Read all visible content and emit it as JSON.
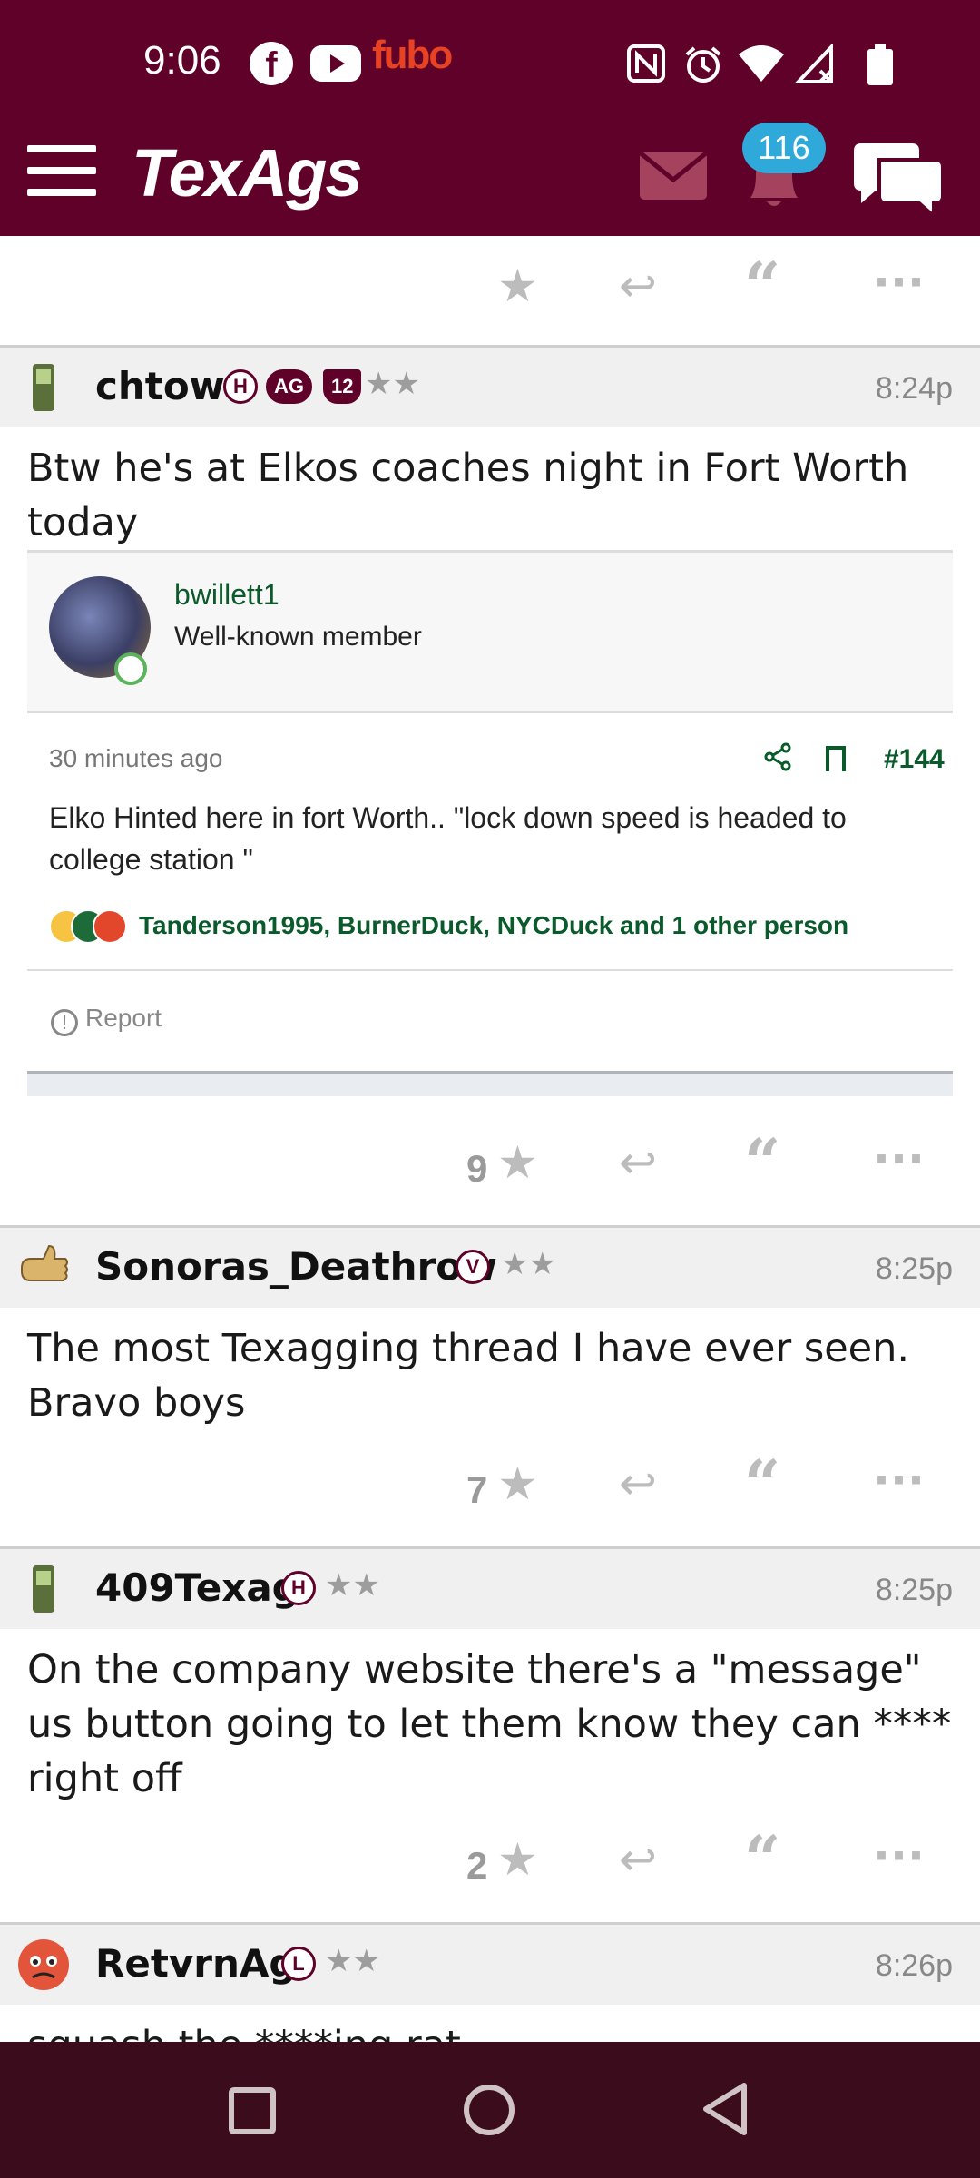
{
  "status_bar": {
    "time": "9:06",
    "left_icons": [
      "facebook-icon",
      "youtube-icon",
      "fubo-icon"
    ],
    "fubo_label": "fubo",
    "right_icons": [
      "nfc-icon",
      "alarm-icon",
      "wifi-icon",
      "signal-icon",
      "battery-icon"
    ]
  },
  "header": {
    "logo": "TexAgs",
    "notifications_count": "116",
    "colors": {
      "brand": "#5f0128",
      "badge": "#2fa9d9"
    }
  },
  "top_actions": {},
  "posts": [
    {
      "username": "chtow",
      "badges": [
        "H",
        "AG",
        "12"
      ],
      "stars": "★★",
      "time": "8:24p",
      "body": "Btw he's at Elkos coaches night in Fort Worth today",
      "embed": {
        "username": "bwillett1",
        "role": "Well-known member",
        "meta": "30 minutes ago",
        "post_number": "#144",
        "text": "Elko Hinted here in fort Worth.. \"lock down speed is headed to college station \"",
        "reactions": "Tanderson1995, BurnerDuck, NYCDuck and 1 other person",
        "report_label": "Report"
      },
      "star_count": "9"
    },
    {
      "username": "Sonoras_Deathrow",
      "badges": [
        "V"
      ],
      "stars": "★★",
      "time": "8:25p",
      "body": "The most Texagging thread I have ever seen. Bravo boys",
      "star_count": "7"
    },
    {
      "username": "409Texag",
      "badges": [
        "H"
      ],
      "stars": "★★",
      "time": "8:25p",
      "body": "On the company website there's a \"message\" us button going to let them know they can **** right off",
      "star_count": "2"
    },
    {
      "username": "RetvrnAg",
      "badges": [
        "L"
      ],
      "stars": "★★",
      "time": "8:26p",
      "body": "squash the ****ing rat"
    }
  ]
}
